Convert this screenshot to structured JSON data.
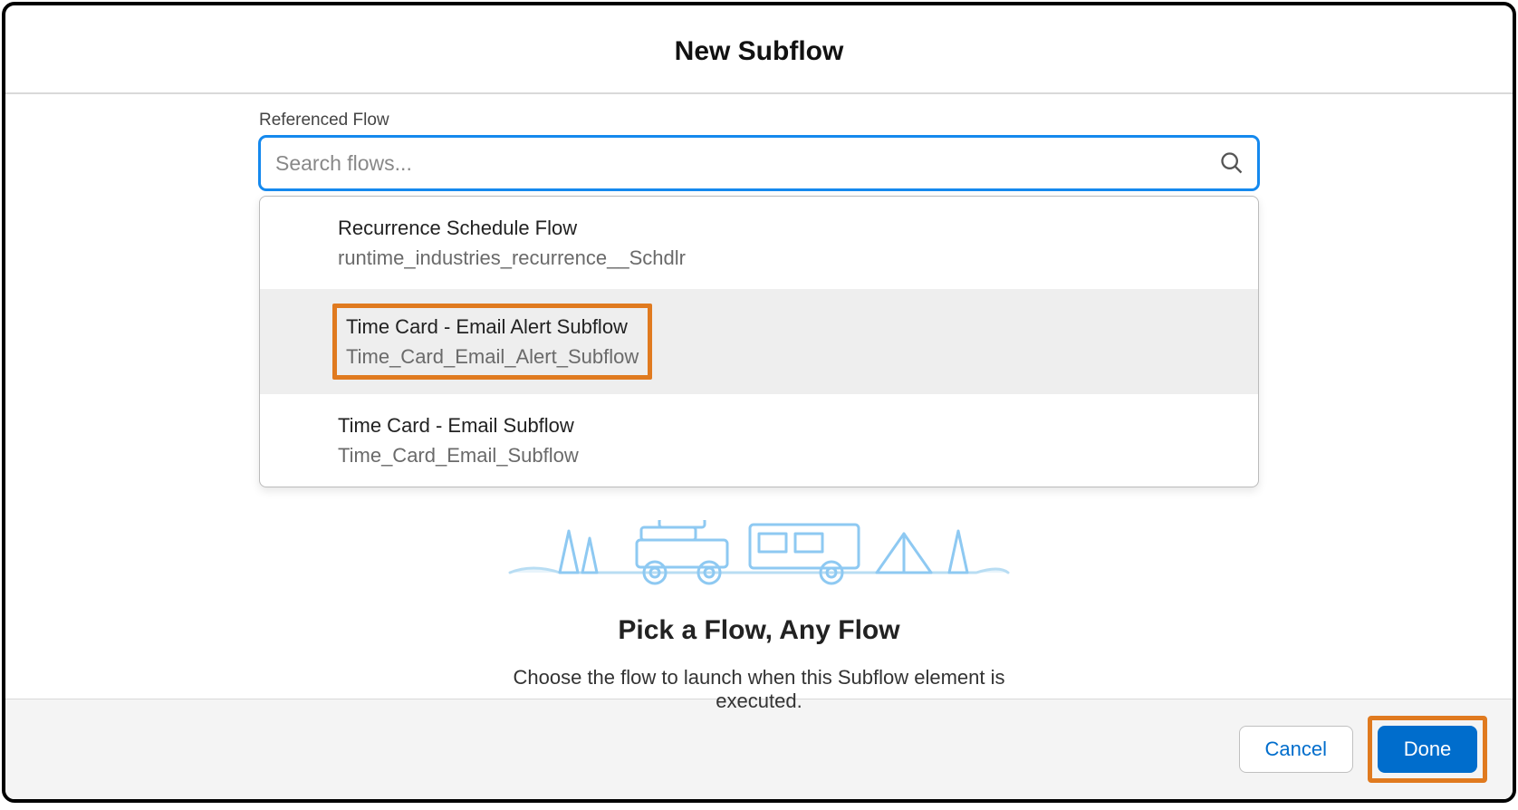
{
  "header": {
    "title": "New Subflow"
  },
  "field": {
    "label": "Referenced Flow",
    "placeholder": "Search flows...",
    "value": ""
  },
  "dropdown": {
    "items": [
      {
        "label": "Recurrence Schedule Flow",
        "api": "runtime_industries_recurrence__Schdlr",
        "highlighted": false,
        "boxed": false
      },
      {
        "label": "Time Card - Email Alert Subflow",
        "api": "Time_Card_Email_Alert_Subflow",
        "highlighted": true,
        "boxed": true
      },
      {
        "label": "Time Card - Email Subflow",
        "api": "Time_Card_Email_Subflow",
        "highlighted": false,
        "boxed": false
      }
    ]
  },
  "empty": {
    "title": "Pick a Flow, Any Flow",
    "subtitle": "Choose the flow to launch when this Subflow element is executed."
  },
  "footer": {
    "cancel": "Cancel",
    "done": "Done"
  }
}
